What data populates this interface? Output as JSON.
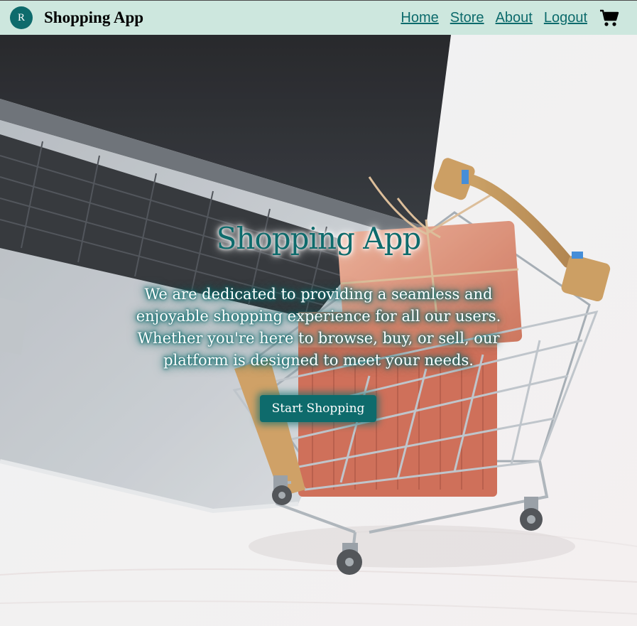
{
  "navbar": {
    "avatar_letter": "R",
    "brand": "Shopping App",
    "links": [
      {
        "label": "Home"
      },
      {
        "label": "Store"
      },
      {
        "label": "About"
      },
      {
        "label": "Logout"
      }
    ],
    "cart_icon": "shopping-cart-icon",
    "background_color": "#cde7de",
    "accent_color": "#0e6b6c"
  },
  "hero": {
    "title": "Shopping App",
    "description": "We are dedicated to providing a seamless and enjoyable shopping experience for all our users. Whether you're here to browse, buy, or sell, our platform is designed to meet your needs.",
    "button_label": "Start Shopping",
    "background_image": "laptop and shopping cart with gift boxes"
  }
}
